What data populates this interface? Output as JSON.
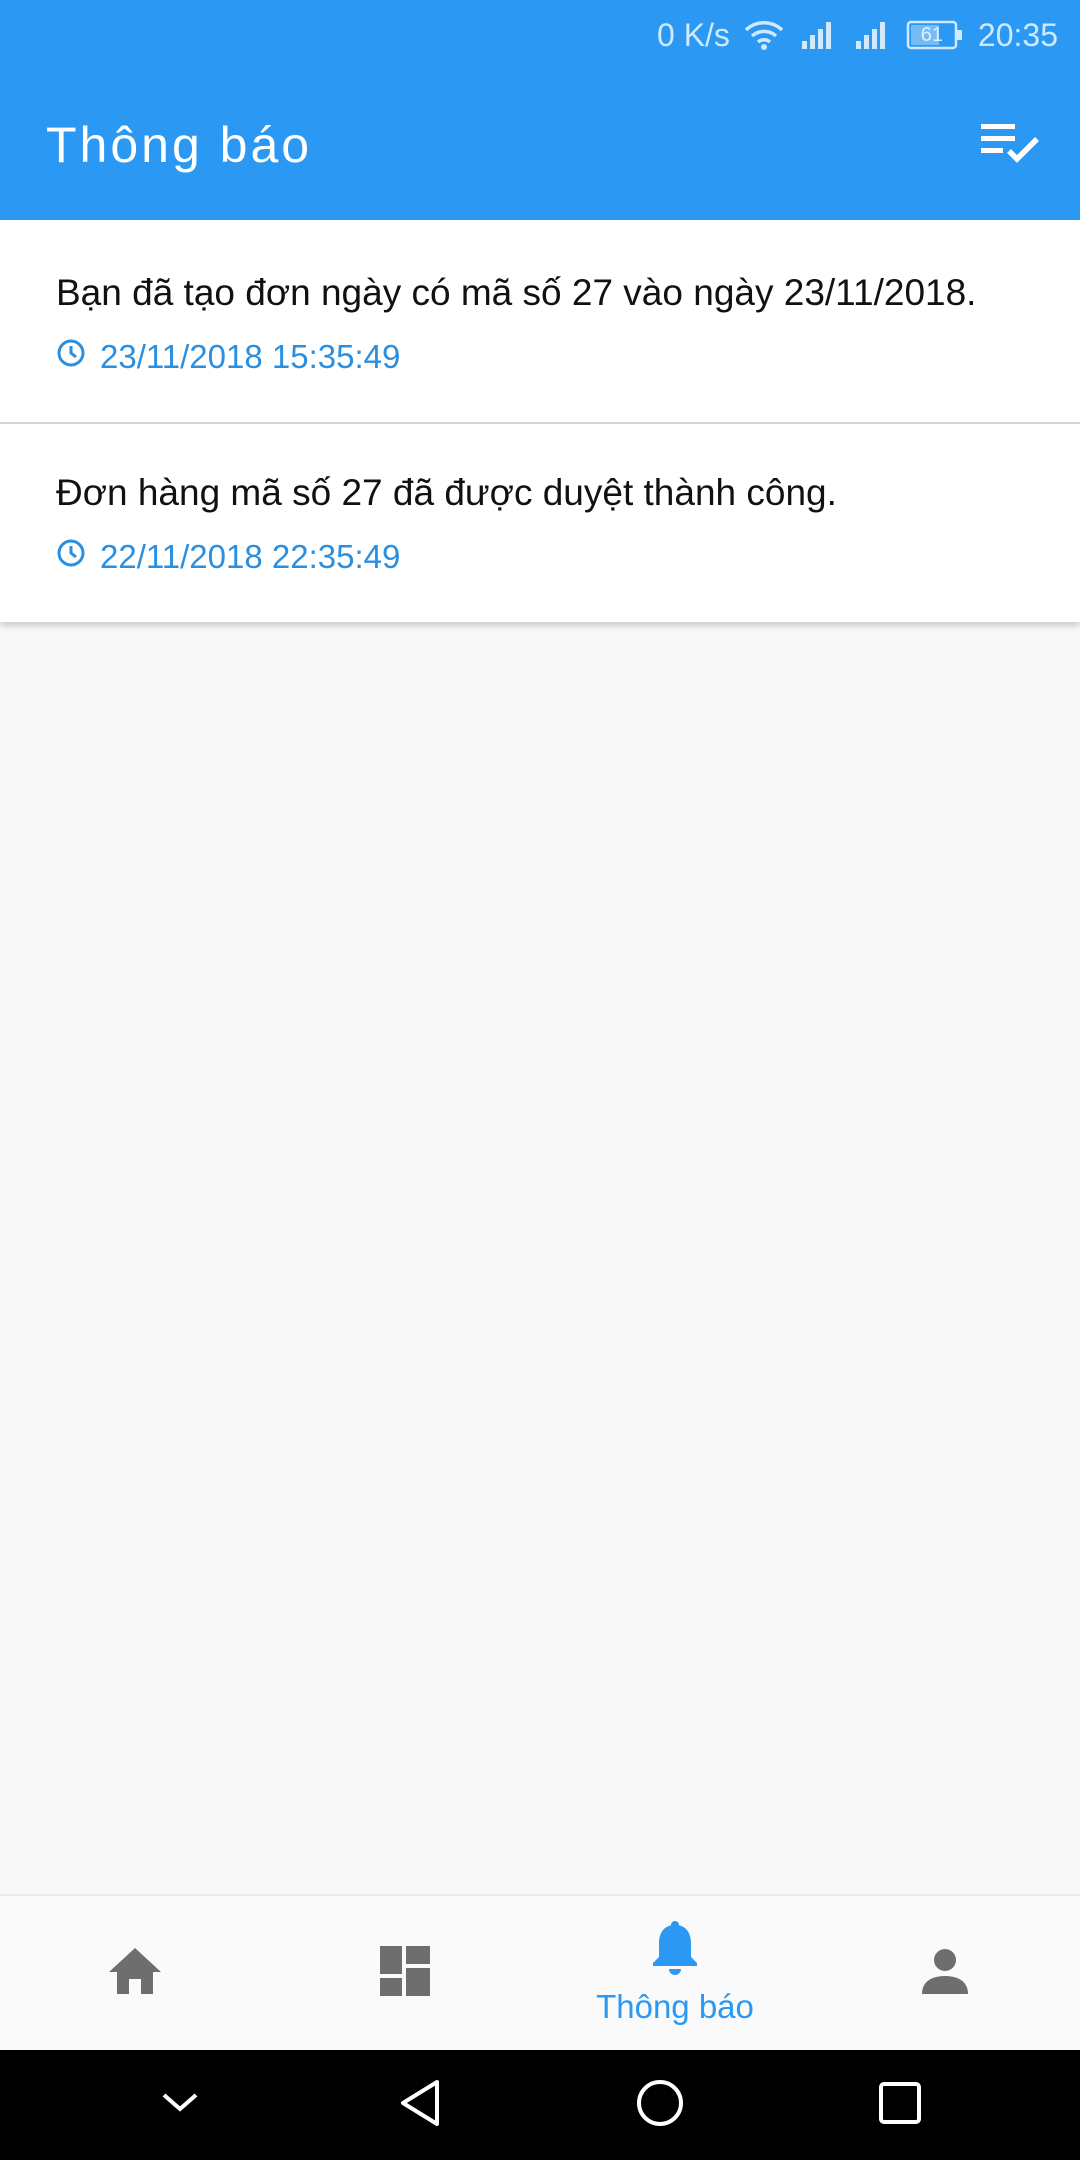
{
  "status_bar": {
    "net_speed": "0 K/s",
    "battery": "61",
    "time": "20:35",
    "icons": [
      "wifi-icon",
      "signal-icon",
      "signal-icon",
      "battery-icon"
    ]
  },
  "app_bar": {
    "title": "Thông báo",
    "action_icon": "mark-all-read-icon"
  },
  "notifications": [
    {
      "message": "Bạn đã tạo đơn ngày có mã số 27 vào ngày 23/11/2018.",
      "timestamp": "23/11/2018 15:35:49"
    },
    {
      "message": "Đơn hàng mã số 27 đã được duyệt thành công.",
      "timestamp": "22/11/2018 22:35:49"
    }
  ],
  "bottom_nav": {
    "items": [
      {
        "icon": "home-icon",
        "label": ""
      },
      {
        "icon": "dashboard-icon",
        "label": ""
      },
      {
        "icon": "bell-icon",
        "label": "Thông báo",
        "active": true
      },
      {
        "icon": "person-icon",
        "label": ""
      }
    ]
  },
  "colors": {
    "primary": "#2b99f3",
    "accent_text": "#2b8fe0",
    "inactive_icon": "#6e6e6e"
  }
}
